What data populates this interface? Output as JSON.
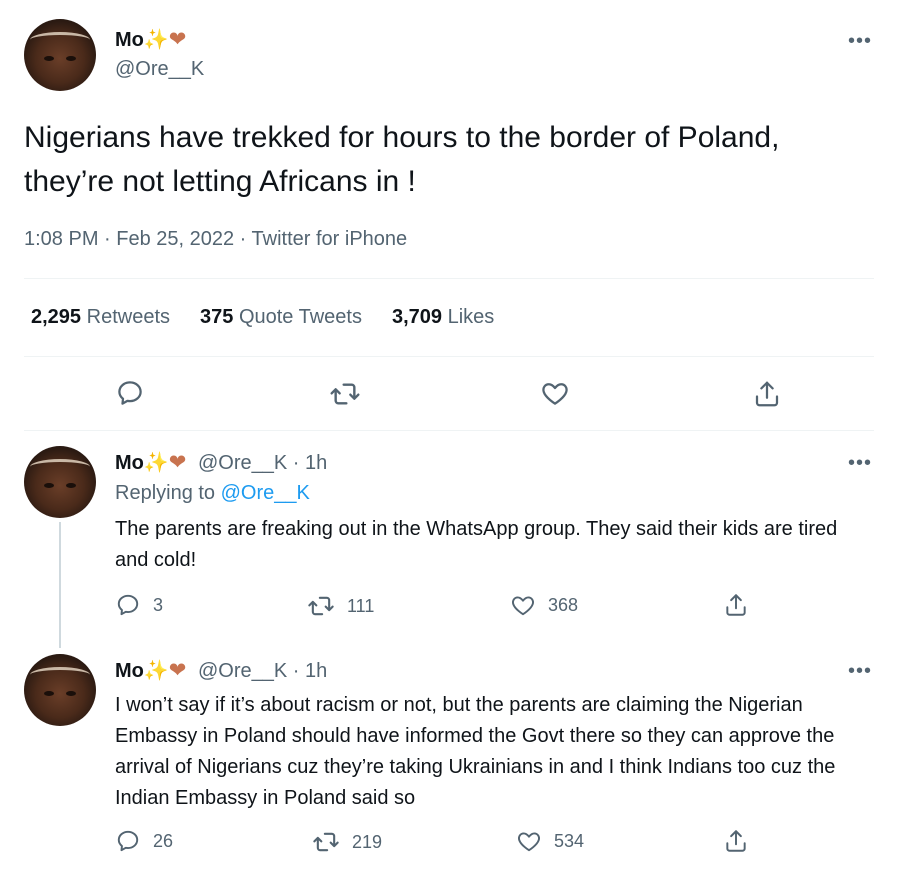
{
  "main_tweet": {
    "name": "Mo✨",
    "heart": "❤",
    "handle": "@Ore__K",
    "more": "•••",
    "text": "Nigerians have trekked for hours to the border of Poland, they’re not letting Africans in !",
    "meta": "1:08 PM · Feb 25, 2022 · Twitter for iPhone",
    "stats": {
      "retweets_num": "2,295",
      "retweets_label": "Retweets",
      "quotes_num": "375",
      "quotes_label": "Quote Tweets",
      "likes_num": "3,709",
      "likes_label": "Likes"
    }
  },
  "replies": [
    {
      "name": "Mo✨",
      "heart": "❤",
      "handle": "@Ore__K",
      "time": "· 1h",
      "replying_prefix": "Replying to",
      "replying_handle": "@Ore__K",
      "text": "The parents are freaking out in the WhatsApp group. They said their kids are tired and cold!",
      "replies": "3",
      "retweets": "111",
      "likes": "368",
      "more": "•••"
    },
    {
      "name": "Mo✨",
      "heart": "❤",
      "handle": "@Ore__K",
      "time": "· 1h",
      "text": "I won’t say if it’s about racism or not, but the parents are claiming the Nigerian Embassy in Poland should have informed the Govt there so they can approve the arrival of Nigerians cuz they’re taking Ukrainians in and I think Indians too cuz the Indian Embassy in Poland said so",
      "replies": "26",
      "retweets": "219",
      "likes": "534",
      "more": "•••"
    }
  ],
  "colors": {
    "text": "#0f1419",
    "muted": "#536471",
    "link": "#1d9bf0",
    "divider": "#eff3f4",
    "heart": "#c8734f"
  }
}
